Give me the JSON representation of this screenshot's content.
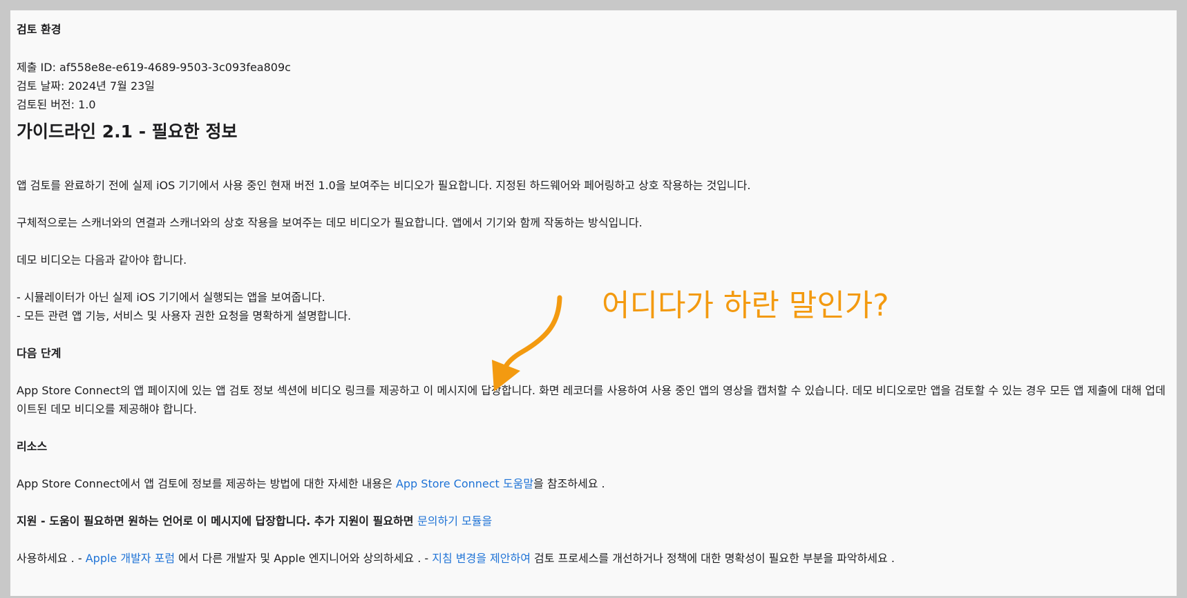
{
  "review_env": {
    "heading": "검토 환경",
    "submission_id": " 제출 ID: af558e8e-e619-4689-9503-3c093fea809c",
    "review_date": "검토 날짜: 2024년 7월 23일",
    "version": "검토된 버전: 1.0"
  },
  "guideline": {
    "title": "가이드라인 2.1 - 필요한 정보",
    "para1": "앱 검토를 완료하기 전에 실제 iOS 기기에서 사용 중인 현재 버전 1.0을 보여주는 비디오가 필요합니다. 지정된 하드웨어와 페어링하고 상호 작용하는 것입니다.",
    "para2": "구체적으로는 스캐너와의 연결과 스캐너와의 상호 작용을 보여주는 데모 비디오가 필요합니다. 앱에서 기기와 함께 작동하는 방식입니다.",
    "para3": "데모 비디오는 다음과 같아야 합니다.",
    "bullet1": "- 시뮬레이터가 아닌 실제 iOS 기기에서 실행되는 앱을 보여줍니다.",
    "bullet2": "- 모든 관련 앱 기능, 서비스 및 사용자 권한 요청을 명확하게 설명합니다."
  },
  "next_steps": {
    "heading": "다음 단계",
    "body": " App Store Connect의 앱 페이지에 있는 앱 검토 정보 섹션에 비디오 링크를 제공하고 이 메시지에 답장합니다. 화면 레코더를 사용하여 사용 중인 앱의 영상을 캡처할 수 있습니다. 데모 비디오로만 앱을 검토할 수 있는 경우 모든 앱 제출에 대해 업데이트된 데모 비디오를 제공해야 합니다."
  },
  "resources": {
    "heading": "리소스",
    "text_before": " App Store Connect에서 앱 검토에 정보를 제공하는 방법에 대한 자세한 내용은 ",
    "link": "App Store Connect 도움말",
    "text_after": "을 참조하세요 ."
  },
  "support": {
    "bold_text": "지원 - 도움이 필요하면 원하는 언어로 이 메시지에 답장합니다. 추가 지원이 필요하면 ",
    "link_contact": "문의하기 모듈을",
    "line2_start": " 사용하세요 . - ",
    "link_forum": "Apple 개발자 포럼",
    "line2_mid": " 에서 다른 개발자 및 Apple 엔지니어와 상의하세요 . - ",
    "link_guideline": "지침 변경을 제안하여",
    "line2_end": " 검토 프로세스를 개선하거나 정책에 대한 명확성이 필요한 부분을 파악하세요 ."
  },
  "annotation": {
    "text": "어디다가 하란 말인가?",
    "color": "#f39a10"
  },
  "colors": {
    "link": "#1f73d6",
    "background": "#f9f9f9",
    "frame": "#c8c8c8"
  }
}
